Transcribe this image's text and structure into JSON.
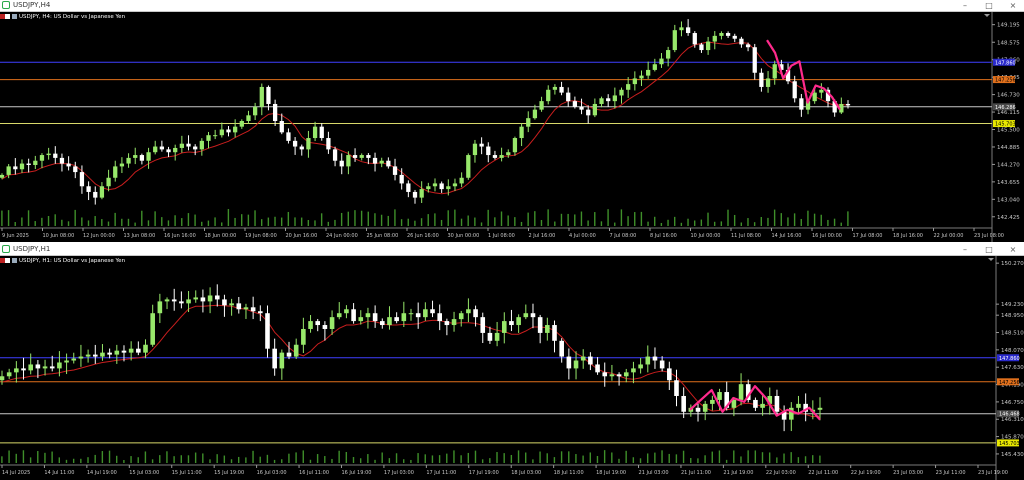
{
  "windows": [
    {
      "id": "h4",
      "title": "USDJPY,H4",
      "symbol_label": "USDJPY, H4:  US Dollar vs Japanese Yen"
    },
    {
      "id": "h1",
      "title": "USDJPY,H1",
      "symbol_label": "USDJPY, H1:  US Dollar vs Japanese Yen"
    }
  ],
  "window_buttons": {
    "minimize": "–",
    "maximize": "□",
    "close": "×"
  },
  "colors": {
    "background": "#000000",
    "bull_candle": "#98e86b",
    "bear_candle": "#ffffff",
    "ma_line": "#c81e1e",
    "marker": "#ff2a8c",
    "blue_level": "#3f3fff",
    "orange_level": "#e0701c",
    "yellow_level": "#d8d86a",
    "white_level": "#c8c8c8",
    "grid_text": "#c8c8c8"
  },
  "chart_data": [
    {
      "type": "candlestick",
      "symbol": "USDJPY",
      "timeframe": "H4",
      "price_ticks": [
        "149.195",
        "148.575",
        "147.960",
        "147.345",
        "146.730",
        "146.115",
        "145.500",
        "144.885",
        "144.270",
        "143.655",
        "143.040",
        "142.425"
      ],
      "y_range": [
        142.1,
        149.5
      ],
      "time_labels": [
        "9 Jun 2025",
        "10 Jun 08:00",
        "12 Jun 00:00",
        "13 Jun 08:00",
        "16 Jun 16:00",
        "18 Jun 00:00",
        "19 Jun 08:00",
        "20 Jun 16:00",
        "24 Jun 00:00",
        "25 Jun 08:00",
        "26 Jun 16:00",
        "30 Jun 00:00",
        "1 Jul 08:00",
        "2 Jul 16:00",
        "4 Jul 00:00",
        "7 Jul 08:00",
        "8 Jul 16:00",
        "10 Jul 00:00",
        "11 Jul 08:00",
        "14 Jul 16:00",
        "16 Jul 00:00",
        "17 Jul 08:00",
        "18 Jul 16:00",
        "22 Jul 00:00",
        "23 Jul 08:00"
      ],
      "levels": [
        {
          "name": "blue",
          "price": 147.87,
          "label": "147.860"
        },
        {
          "name": "orange",
          "price": 147.26,
          "label": "147.256"
        },
        {
          "name": "white",
          "price": 146.3,
          "label": "146.286"
        },
        {
          "name": "yellow",
          "price": 145.71,
          "label": "145.703"
        }
      ],
      "close_path": [
        143.9,
        144.2,
        144.1,
        144.3,
        144.25,
        144.4,
        144.6,
        144.65,
        144.5,
        144.3,
        144.2,
        144.0,
        143.5,
        143.3,
        143.1,
        143.5,
        143.8,
        144.2,
        144.3,
        144.5,
        144.6,
        144.4,
        144.7,
        144.9,
        144.8,
        144.7,
        144.85,
        145.0,
        144.9,
        144.8,
        145.1,
        145.3,
        145.3,
        145.5,
        145.4,
        145.6,
        145.8,
        146.0,
        146.3,
        147.0,
        146.4,
        145.8,
        145.4,
        145.1,
        144.9,
        144.8,
        145.2,
        145.6,
        145.2,
        144.8,
        144.4,
        144.2,
        144.6,
        144.5,
        144.6,
        144.5,
        144.3,
        144.4,
        144.2,
        143.9,
        143.6,
        143.3,
        143.1,
        143.4,
        143.5,
        143.6,
        143.4,
        143.5,
        143.6,
        143.8,
        144.6,
        145.0,
        144.9,
        144.6,
        144.5,
        144.6,
        144.7,
        145.2,
        145.6,
        145.9,
        146.2,
        146.5,
        146.9,
        147.0,
        146.8,
        146.5,
        146.3,
        146.2,
        146.0,
        146.4,
        146.6,
        146.5,
        146.7,
        146.9,
        147.1,
        147.3,
        147.4,
        147.6,
        147.8,
        148.0,
        148.3,
        149.0,
        149.1,
        148.9,
        148.5,
        148.3,
        148.6,
        148.8,
        148.9,
        148.8,
        148.7,
        148.5,
        148.4,
        147.5,
        147.0,
        147.3,
        147.8,
        147.6,
        147.2,
        146.6,
        146.2,
        146.5,
        146.8,
        146.9,
        146.5,
        146.1,
        146.4,
        146.35
      ],
      "marker_path": [
        148.65,
        148.2,
        147.3,
        147.75,
        147.9,
        146.45,
        147.05,
        146.95,
        146.65,
        146.2
      ]
    },
    {
      "type": "candlestick",
      "symbol": "USDJPY",
      "timeframe": "H1",
      "price_ticks": [
        "150.270",
        "149.230",
        "148.950",
        "148.510",
        "148.070",
        "147.630",
        "147.190",
        "146.750",
        "146.310",
        "145.870",
        "145.430"
      ],
      "y_range": [
        145.2,
        150.35
      ],
      "time_labels": [
        "14 Jul 2025",
        "14 Jul 11:00",
        "14 Jul 19:00",
        "15 Jul 03:00",
        "15 Jul 11:00",
        "15 Jul 19:00",
        "16 Jul 03:00",
        "16 Jul 11:00",
        "16 Jul 19:00",
        "17 Jul 03:00",
        "17 Jul 11:00",
        "17 Jul 19:00",
        "18 Jul 03:00",
        "18 Jul 11:00",
        "18 Jul 19:00",
        "21 Jul 03:00",
        "21 Jul 11:00",
        "21 Jul 19:00",
        "22 Jul 03:00",
        "22 Jul 11:00",
        "22 Jul 19:00",
        "23 Jul 03:00",
        "23 Jul 11:00",
        "23 Jul 19:00"
      ],
      "levels": [
        {
          "name": "blue",
          "price": 147.87,
          "label": "147.860"
        },
        {
          "name": "orange",
          "price": 147.26,
          "label": "147.256"
        },
        {
          "name": "white",
          "price": 146.45,
          "label": "146.468"
        },
        {
          "name": "yellow",
          "price": 145.71,
          "label": "145.703"
        }
      ],
      "close_path": [
        147.4,
        147.5,
        147.6,
        147.55,
        147.7,
        147.6,
        147.65,
        147.6,
        147.75,
        147.8,
        147.85,
        147.9,
        147.95,
        147.9,
        148.0,
        147.95,
        148.05,
        148.0,
        148.1,
        148.0,
        148.2,
        149.0,
        149.3,
        149.35,
        149.3,
        149.25,
        149.35,
        149.4,
        149.3,
        149.45,
        149.35,
        149.2,
        149.25,
        149.1,
        149.15,
        149.05,
        149.0,
        148.1,
        147.6,
        148.0,
        147.9,
        148.2,
        148.6,
        148.8,
        148.7,
        148.6,
        148.9,
        149.0,
        149.1,
        148.8,
        148.9,
        149.0,
        148.8,
        148.7,
        148.9,
        148.8,
        149.0,
        149.0,
        148.9,
        149.1,
        149.0,
        148.8,
        148.7,
        148.85,
        149.0,
        149.1,
        148.9,
        148.5,
        148.3,
        148.5,
        148.8,
        148.7,
        148.9,
        149.0,
        148.9,
        148.5,
        148.7,
        148.3,
        147.9,
        147.6,
        147.8,
        147.9,
        147.7,
        147.5,
        147.4,
        147.45,
        147.4,
        147.5,
        147.6,
        147.7,
        147.9,
        147.8,
        147.6,
        147.3,
        146.9,
        146.5,
        146.6,
        146.5,
        146.7,
        146.8,
        147.0,
        146.6,
        146.8,
        147.2,
        146.8,
        146.6,
        146.7,
        146.9,
        146.5,
        146.3,
        146.6,
        146.7,
        146.5,
        146.55,
        146.6
      ],
      "marker_path": [
        146.55,
        146.8,
        147.05,
        146.5,
        146.85,
        146.75,
        147.15,
        146.85,
        146.4,
        146.55,
        146.45,
        146.6,
        146.3
      ]
    }
  ]
}
